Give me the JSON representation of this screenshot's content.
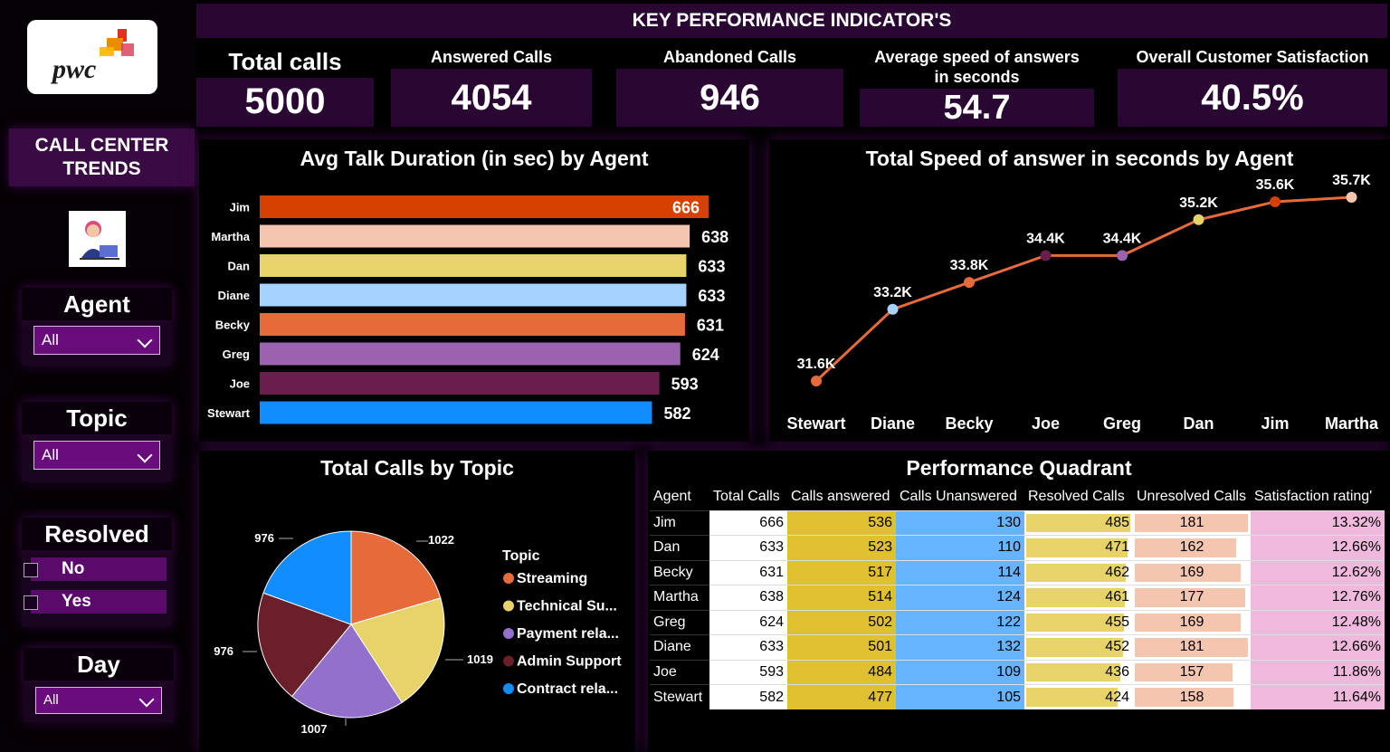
{
  "logo": {
    "text": "pwc"
  },
  "sidebar": {
    "title": "CALL CENTER TRENDS",
    "filters": {
      "agent": {
        "label": "Agent",
        "value": "All"
      },
      "topic": {
        "label": "Topic",
        "value": "All"
      },
      "resolved": {
        "label": "Resolved",
        "options": [
          "No",
          "Yes"
        ]
      },
      "day": {
        "label": "Day",
        "value": "All"
      }
    }
  },
  "kpi": {
    "header": "KEY PERFORMANCE INDICATOR'S",
    "cards": [
      {
        "label": "Total calls",
        "value": "5000"
      },
      {
        "label": "Answered Calls",
        "value": "4054"
      },
      {
        "label": "Abandoned Calls",
        "value": "946"
      },
      {
        "label": "Average speed of answers in seconds",
        "value": "54.7"
      },
      {
        "label": "Overall Customer Satisfaction",
        "value": "40.5%"
      }
    ]
  },
  "chart_data": [
    {
      "type": "bar",
      "orientation": "horizontal",
      "title": "Avg Talk Duration (in sec) by Agent",
      "categories": [
        "Jim",
        "Martha",
        "Dan",
        "Diane",
        "Becky",
        "Greg",
        "Joe",
        "Stewart"
      ],
      "values": [
        666,
        638,
        633,
        633,
        631,
        624,
        593,
        582
      ],
      "colors": [
        "#d64000",
        "#f4c5af",
        "#e8d26a",
        "#a6d2ff",
        "#e76b3a",
        "#9b62b0",
        "#6a1e4e",
        "#118dff"
      ]
    },
    {
      "type": "line",
      "title": "Total Speed of answer in seconds by Agent",
      "categories": [
        "Stewart",
        "Diane",
        "Becky",
        "Joe",
        "Greg",
        "Dan",
        "Jim",
        "Martha"
      ],
      "values": [
        31.6,
        33.2,
        33.8,
        34.4,
        34.4,
        35.2,
        35.6,
        35.7
      ],
      "labels": [
        "31.6K",
        "33.2K",
        "33.8K",
        "34.4K",
        "34.4K",
        "35.2K",
        "35.6K",
        "35.7K"
      ],
      "line_color": "#e76b3a",
      "point_colors": [
        "#e76b3a",
        "#a6d2ff",
        "#e76b3a",
        "#6a1e4e",
        "#9b62b0",
        "#e8d26a",
        "#d64000",
        "#f4c5af"
      ]
    },
    {
      "type": "pie",
      "title": "Total Calls by Topic",
      "legend_title": "Topic",
      "categories": [
        "Streaming",
        "Technical Su...",
        "Payment rela...",
        "Admin Support",
        "Contract rela..."
      ],
      "values": [
        1022,
        1019,
        1007,
        976,
        976
      ],
      "colors": [
        "#e76b3a",
        "#e8d26a",
        "#9370cc",
        "#6b1f2a",
        "#118dff"
      ]
    }
  ],
  "table": {
    "title": "Performance Quadrant",
    "columns": [
      "Agent",
      "Total Calls",
      "Calls answered",
      "Calls Unanswered",
      "Resolved Calls",
      "Unresolved Calls",
      "Satisfaction rating'"
    ],
    "rows": [
      [
        "Jim",
        "666",
        "536",
        "130",
        "485",
        "181",
        "13.32%"
      ],
      [
        "Dan",
        "633",
        "523",
        "110",
        "471",
        "162",
        "12.66%"
      ],
      [
        "Becky",
        "631",
        "517",
        "114",
        "462",
        "169",
        "12.62%"
      ],
      [
        "Martha",
        "638",
        "514",
        "124",
        "461",
        "177",
        "12.76%"
      ],
      [
        "Greg",
        "624",
        "502",
        "122",
        "455",
        "169",
        "12.48%"
      ],
      [
        "Diane",
        "633",
        "501",
        "132",
        "452",
        "181",
        "12.66%"
      ],
      [
        "Joe",
        "593",
        "484",
        "109",
        "436",
        "157",
        "11.86%"
      ],
      [
        "Stewart",
        "582",
        "477",
        "105",
        "424",
        "158",
        "11.64%"
      ]
    ],
    "colors": {
      "answered": "#e0c030",
      "unanswered": "#66b4ff",
      "resolved_bar": "#e8d26a",
      "unresolved_bar": "#f4c5af",
      "satisfaction": "#f0b8dc"
    }
  }
}
